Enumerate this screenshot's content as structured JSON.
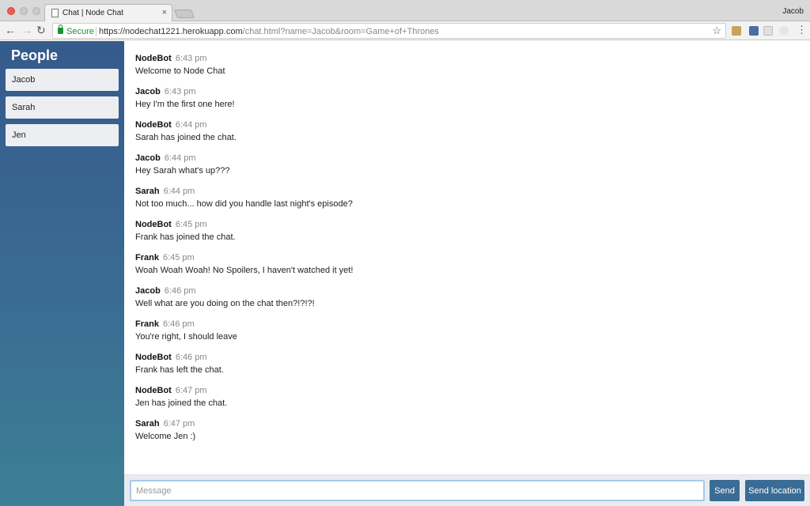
{
  "browser": {
    "tab_title": "Chat | Node Chat",
    "tab_close": "×",
    "profile_name": "Jacob",
    "secure_label": "Secure",
    "url_main": "https://nodechat1221.herokuapp.com",
    "url_rest": "/chat.html?name=Jacob&room=Game+of+Thrones",
    "icons": {
      "back": "←",
      "forward": "→",
      "reload": "↻",
      "star": "☆",
      "menu": "⋮"
    }
  },
  "sidebar": {
    "title": "People",
    "people": [
      "Jacob",
      "Sarah",
      "Jen"
    ]
  },
  "messages": [
    {
      "name": "NodeBot",
      "time": "6:43 pm",
      "text": "Welcome to Node Chat"
    },
    {
      "name": "Jacob",
      "time": "6:43 pm",
      "text": "Hey I'm the first one here!"
    },
    {
      "name": "NodeBot",
      "time": "6:44 pm",
      "text": "Sarah has joined the chat."
    },
    {
      "name": "Jacob",
      "time": "6:44 pm",
      "text": "Hey Sarah what's up???"
    },
    {
      "name": "Sarah",
      "time": "6:44 pm",
      "text": "Not too much... how did you handle last night's episode?"
    },
    {
      "name": "NodeBot",
      "time": "6:45 pm",
      "text": "Frank has joined the chat."
    },
    {
      "name": "Frank",
      "time": "6:45 pm",
      "text": "Woah Woah Woah! No Spoilers, I haven't watched it yet!"
    },
    {
      "name": "Jacob",
      "time": "6:46 pm",
      "text": "Well what are you doing on the chat then?!?!?!"
    },
    {
      "name": "Frank",
      "time": "6:46 pm",
      "text": "You're right, I should leave"
    },
    {
      "name": "NodeBot",
      "time": "6:46 pm",
      "text": "Frank has left the chat."
    },
    {
      "name": "NodeBot",
      "time": "6:47 pm",
      "text": "Jen has joined the chat."
    },
    {
      "name": "Sarah",
      "time": "6:47 pm",
      "text": "Welcome Jen :)"
    }
  ],
  "composer": {
    "placeholder": "Message",
    "send_label": "Send",
    "location_label": "Send location"
  }
}
